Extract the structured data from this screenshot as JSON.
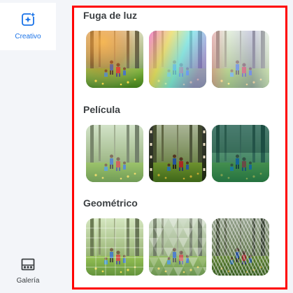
{
  "sidebar": {
    "creativo": {
      "label": "Creativo",
      "icon": "sparkle-add-icon"
    },
    "galeria": {
      "label": "Galería",
      "icon": "gallery-icon"
    }
  },
  "sections": [
    {
      "title": "Fuga de luz",
      "thumbs": [
        {
          "name": "light-leak-warm",
          "effect": "warm"
        },
        {
          "name": "light-leak-rainbow",
          "effect": "rainbow"
        },
        {
          "name": "light-leak-pastel",
          "effect": "pastel"
        }
      ]
    },
    {
      "title": "Película",
      "thumbs": [
        {
          "name": "film-faded",
          "effect": "faded"
        },
        {
          "name": "film-vintage",
          "effect": "vintage"
        },
        {
          "name": "film-teal",
          "effect": "teal"
        }
      ]
    },
    {
      "title": "Geométrico",
      "thumbs": [
        {
          "name": "geometric-grid",
          "effect": "grid"
        },
        {
          "name": "geometric-triangles",
          "effect": "triangles"
        },
        {
          "name": "geometric-pattern",
          "effect": "pattern"
        }
      ]
    }
  ],
  "colors": {
    "accent": "#1a73e8",
    "highlight_border": "#ff0000"
  }
}
